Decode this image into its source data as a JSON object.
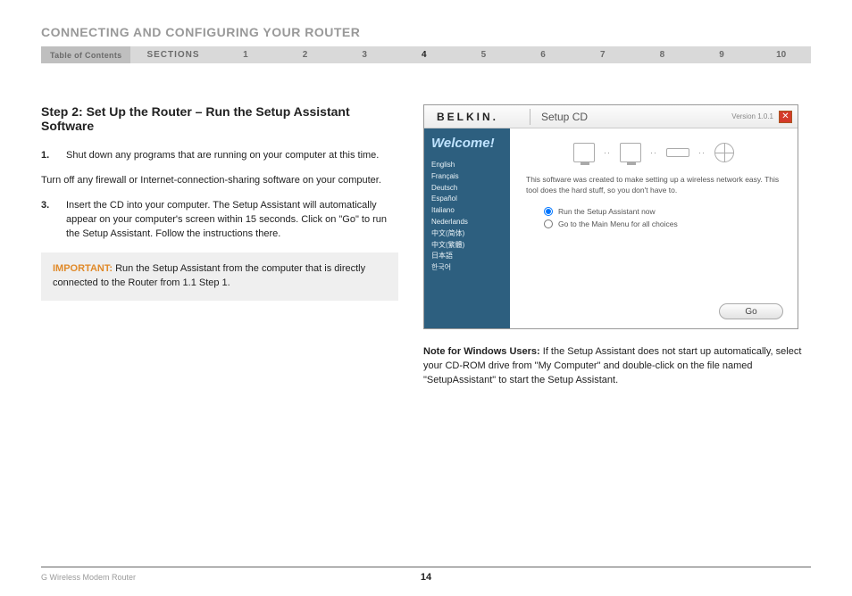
{
  "header": {
    "title": "CONNECTING AND CONFIGURING YOUR ROUTER"
  },
  "nav": {
    "toc_label": "Table of Contents",
    "sections_label": "SECTIONS",
    "items": [
      "1",
      "2",
      "3",
      "4",
      "5",
      "6",
      "7",
      "8",
      "9",
      "10"
    ],
    "active_index": 3
  },
  "step": {
    "heading": "Step 2: Set Up the Router – Run the Setup Assistant Software",
    "items": [
      {
        "num": "1.",
        "text": "Shut down any programs that are running on your computer at this time."
      }
    ],
    "mid_para": "Turn off any firewall or Internet-connection-sharing software on your computer.",
    "items2": [
      {
        "num": "3.",
        "text": "Insert the CD into your computer. The Setup Assistant will automatically appear on your computer's screen within 15 seconds. Click on \"Go\" to run the Setup Assistant. Follow the instructions there."
      }
    ]
  },
  "important": {
    "label": "IMPORTANT:",
    "text": " Run the Setup Assistant from the computer that is directly connected to the Router from 1.1 Step 1."
  },
  "app": {
    "brand": "BELKIN",
    "brand_dot": ".",
    "window_label": "Setup CD",
    "version": "Version 1.0.1",
    "welcome": "Welcome!",
    "languages": [
      "English",
      "Français",
      "Deutsch",
      "Español",
      "Italiano",
      "Nederlands",
      "中文(简体)",
      "中文(繁體)",
      "日本語",
      "한국어"
    ],
    "description": "This software was created to make setting up a wireless network easy. This tool does the hard stuff, so you don't have to.",
    "radio1": "Run the Setup Assistant now",
    "radio2": "Go to the Main Menu for all choices",
    "go_label": "Go"
  },
  "note": {
    "label": "Note for Windows Users:",
    "text": " If the Setup Assistant does not start up automatically, select your CD-ROM drive from \"My Computer\" and double-click on the file named \"SetupAssistant\" to start the Setup Assistant."
  },
  "footer": {
    "product": "G Wireless Modem Router",
    "page": "14"
  }
}
